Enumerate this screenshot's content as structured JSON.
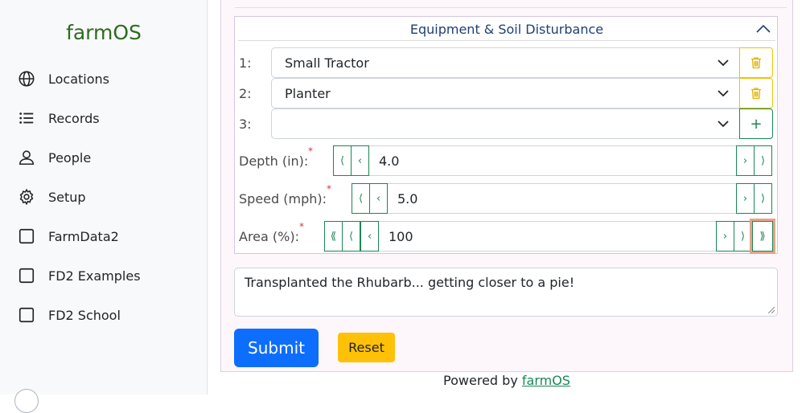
{
  "sidebar": {
    "logo": "farmOS",
    "items": [
      {
        "label": "Locations",
        "icon": "globe-icon"
      },
      {
        "label": "Records",
        "icon": "list-icon"
      },
      {
        "label": "People",
        "icon": "person-icon"
      },
      {
        "label": "Setup",
        "icon": "gear-icon"
      },
      {
        "label": "FarmData2",
        "icon": "square-icon"
      },
      {
        "label": "FD2 Examples",
        "icon": "square-icon"
      },
      {
        "label": "FD2 School",
        "icon": "square-icon"
      }
    ]
  },
  "equipment": {
    "title": "Equipment & Soil Disturbance",
    "rows": [
      {
        "num": "1:",
        "value": "Small Tractor"
      },
      {
        "num": "2:",
        "value": "Planter"
      },
      {
        "num": "3:",
        "value": ""
      }
    ],
    "add_label": "+"
  },
  "fields": {
    "depth": {
      "label": "Depth (in):",
      "value": "4.0"
    },
    "speed": {
      "label": "Speed (mph):",
      "value": "5.0"
    },
    "area": {
      "label": "Area (%):",
      "value": "100"
    },
    "required_mark": "*"
  },
  "comment": "Transplanted the Rhubarb... getting closer to a pie!",
  "buttons": {
    "submit": "Submit",
    "reset": "Reset"
  },
  "footer": {
    "prefix": "Powered by ",
    "link": "farmOS"
  },
  "colors": {
    "primary": "#0d6efd",
    "success": "#198754",
    "warning": "#ffc107",
    "danger": "#dc3545",
    "brand": "#2e6b1f"
  }
}
